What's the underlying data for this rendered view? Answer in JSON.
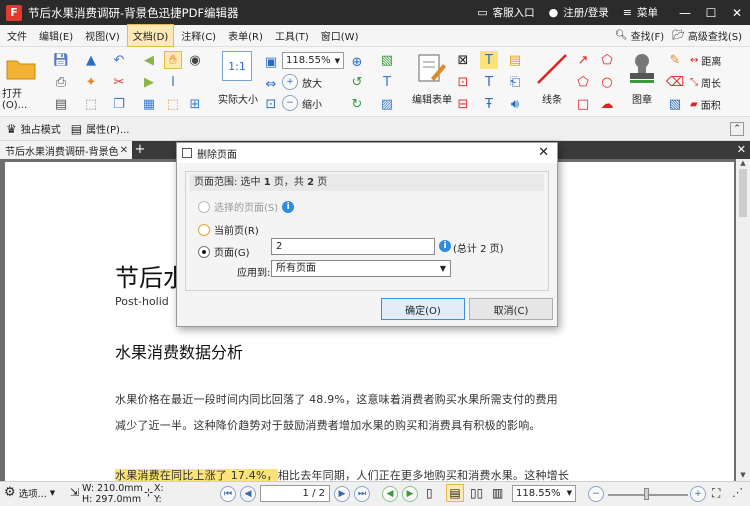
{
  "titlebar": {
    "title": "节后水果消费调研-背景色迅捷PDF编辑器",
    "logo_letter": "F",
    "service_label": "客服入口",
    "login_label": "注册/登录",
    "menu_label": "菜单"
  },
  "menubar": {
    "items": [
      "文件",
      "编辑(E)",
      "视图(V)",
      "文档(D)",
      "注释(C)",
      "表单(R)",
      "工具(T)",
      "窗口(W)"
    ],
    "find_label": "查找(F)",
    "advanced_find_label": "高级查找(S)"
  },
  "ribbon": {
    "open_label": "打开(O)...",
    "zoom_value": "118.55%",
    "actual_size_label": "实际大小",
    "zoom_in_label": "放大",
    "zoom_out_label": "缩小",
    "edit_form_label": "编辑表单",
    "line_label": "线条",
    "stamp_label": "图章",
    "distance_label": "距离",
    "perimeter_label": "周长",
    "area_label": "面积"
  },
  "modebar": {
    "exclusive_label": "独占模式",
    "properties_label": "属性(P)..."
  },
  "tabs": {
    "doc_tab_label": "节后水果消费调研-背景色"
  },
  "document": {
    "title": "节后水",
    "subtitle": "Post-holid",
    "heading": "水果消费数据分析",
    "para1_line1": "水果价格在最近一段时间内同比回落了 48.9%，这意味着消费者购买水果所需支付的费用",
    "para1_line2": "减少了近一半。这种降价趋势对于鼓励消费者增加水果的购买和消费具有积极的影响。",
    "para2_highlight": "水果消费在同比上涨了 17.4%，",
    "para2_rest": "相比去年同期，人们正在更多地购买和消费水果。这种增长"
  },
  "dialog": {
    "title": "删除页面",
    "range_prefix": "页面范围: 选中 ",
    "range_selected": "1",
    "range_mid": " 页，共 ",
    "range_total": "2",
    "range_suffix": " 页",
    "option_selected_pages": "选择的页面(S)",
    "option_current_page": "当前页(R)",
    "option_pages": "页面(G)",
    "pages_value": "2",
    "total_text": "(总计 2 页)",
    "apply_label": "应用到:",
    "apply_value": "所有页面",
    "ok_label": "确定(O)",
    "cancel_label": "取消(C)"
  },
  "statusbar": {
    "options_label": "选项...",
    "width_label": "W: 210.0mm",
    "height_label": "H: 297.0mm",
    "x_label": "X:",
    "y_label": "Y:",
    "page_value": "1 / 2",
    "zoom_value": "118.55%"
  },
  "colors": {
    "titlebar_bg": "#2b2b2b",
    "accent_active_tab": "#fde9b5",
    "highlight": "#fbe27a",
    "primary_btn_border": "#3c8ed8"
  }
}
